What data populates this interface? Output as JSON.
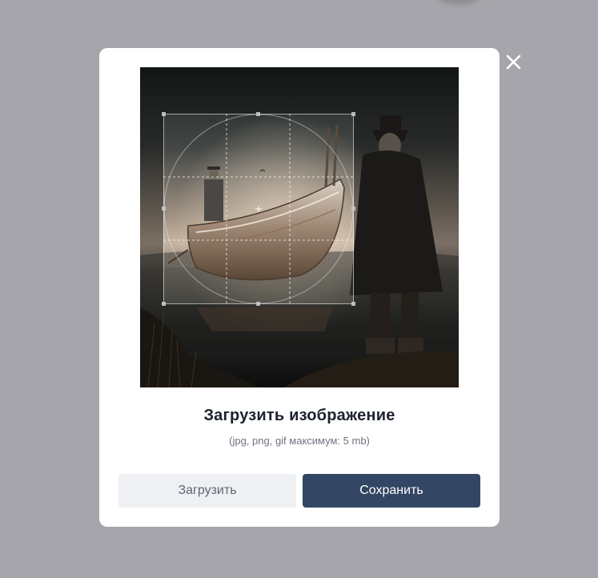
{
  "dialog": {
    "title": "Загрузить изображение",
    "subtitle": "(jpg, png, gif максимум: 5 mb)",
    "upload_label": "Загрузить",
    "save_label": "Сохранить",
    "close_icon": "close-icon"
  },
  "colors": {
    "backdrop": "#a6a5ab",
    "modal": "#ffffff",
    "primary_button": "#334664",
    "secondary_button": "#eef0f3"
  }
}
